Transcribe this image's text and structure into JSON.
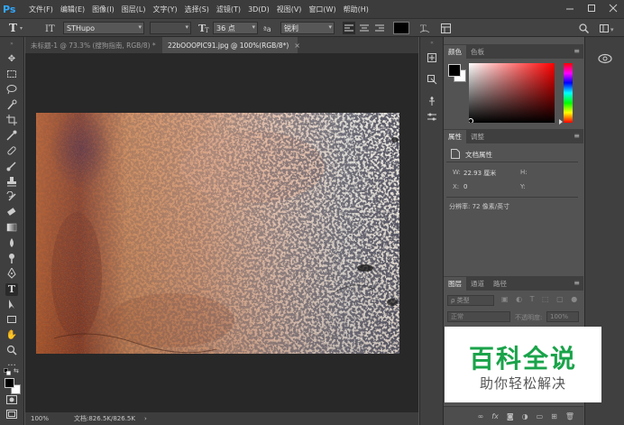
{
  "app": {
    "logo_text": "Ps",
    "menu": [
      "文件(F)",
      "编辑(E)",
      "图像(I)",
      "图层(L)",
      "文字(Y)",
      "选择(S)",
      "滤镜(T)",
      "3D(D)",
      "视图(V)",
      "窗口(W)",
      "帮助(H)"
    ],
    "window_controls": [
      "minimize-icon",
      "maximize-icon",
      "close-icon"
    ]
  },
  "options_bar": {
    "tool_icon": "text-tool-icon",
    "orientation_icon": "text-orientation-icon",
    "font_family": "STHupo",
    "font_style": "",
    "size_icon": "font-size-icon",
    "font_size": "36 点",
    "aa_icon": "anti-alias-icon",
    "anti_alias": "锐利",
    "align_icons": [
      "align-left-icon",
      "align-center-icon",
      "align-right-icon"
    ],
    "text_color": "#000000",
    "warp_icon": "warp-text-icon",
    "panels_icon": "character-panel-icon",
    "search_icon": "search-icon",
    "workspace_icon": "workspace-icon"
  },
  "tools": [
    "move-icon",
    "marquee-icon",
    "lasso-icon",
    "quick-select-icon",
    "crop-icon",
    "eyedropper-icon",
    "healing-icon",
    "brush-icon",
    "stamp-icon",
    "history-brush-icon",
    "eraser-icon",
    "gradient-icon",
    "blur-icon",
    "dodge-icon",
    "pen-icon",
    "type-icon",
    "path-select-icon",
    "rectangle-icon",
    "hand-icon",
    "zoom-icon",
    "more-icon"
  ],
  "tabs": [
    {
      "label": "未标题-1 @ 73.3% (搜狗指南, RGB/8) *",
      "close": "×"
    },
    {
      "label": "22bOOOPIC91.jpg @ 100%(RGB/8*)",
      "close": "×"
    }
  ],
  "status": {
    "zoom": "100%",
    "doc_info": "文档:826.5K/826.5K",
    "arrow": "›"
  },
  "color_panel": {
    "tabs": [
      "颜色",
      "色板"
    ],
    "foreground": "#000000",
    "background": "#ffffff"
  },
  "properties_panel": {
    "tabs": [
      "属性",
      "调整"
    ],
    "title": "文档属性",
    "w_label": "W:",
    "w_value": "22.93 厘米",
    "h_label": "H:",
    "x_label": "X:",
    "x_value": "0",
    "y_label": "Y:",
    "resolution": "分辨率: 72 像素/英寸"
  },
  "layers_panel": {
    "tabs": [
      "图层",
      "通道",
      "路径"
    ],
    "filter_label": "ρ 类型",
    "blend_mode": "正常",
    "opacity_label": "不透明度:",
    "opacity_value": "100%",
    "footer_icons": [
      "link-icon",
      "fx-icon",
      "mask-icon",
      "adjustment-icon",
      "group-icon",
      "new-layer-icon",
      "delete-icon"
    ]
  },
  "watermark": {
    "title": "百科全说",
    "subtitle": "助你轻松解决"
  }
}
